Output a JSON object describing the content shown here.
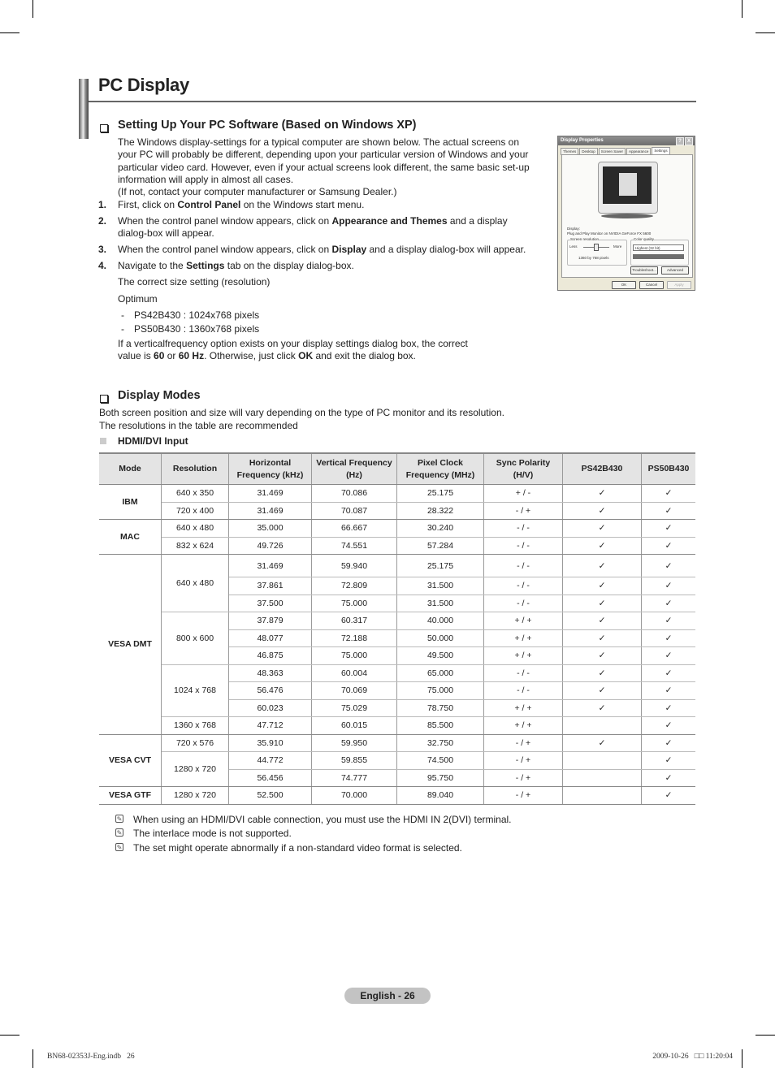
{
  "page": {
    "title": "PC Display",
    "page_label": "English - 26",
    "footer_left": "BN68-02353J-Eng.indb   26",
    "footer_right": "2009-10-26   □□ 11:20:04"
  },
  "setup_section": {
    "heading": "Setting Up Your PC Software (Based on Windows XP)",
    "intro": "The Windows display-settings for a typical computer are shown below. The actual screens on your PC will probably be different, depending upon your particular version of Windows and your particular video card. However, even if your actual screens look different, the same basic set-up information will apply in almost all cases.",
    "intro_note": "(If not, contact your computer manufacturer or Samsung Dealer.)",
    "steps": [
      {
        "num": "1.",
        "before": "First, click on ",
        "bold": "Control Panel",
        "after": " on the Windows start menu."
      },
      {
        "num": "2.",
        "before": "When the control panel window appears, click on ",
        "bold": "Appearance and Themes",
        "after": " and a display dialog-box will appear."
      },
      {
        "num": "3.",
        "before": "When the control panel window appears, click on ",
        "bold": "Display",
        "after": " and a display dialog-box will appear."
      },
      {
        "num": "4.",
        "before": "Navigate to the ",
        "bold": "Settings",
        "after": " tab on the display dialog-box."
      }
    ],
    "correct_size": "The correct size setting (resolution)",
    "optimum": "Optimum",
    "optimum_items": [
      "PS42B430 : 1024x768 pixels",
      "PS50B430 : 1360x768 pixels"
    ],
    "freq_text_1": "If a verticalfrequency option exists on your display settings dialog box, the correct",
    "freq_text_2_a": "value is ",
    "freq_text_2_b1": "60",
    "freq_text_2_c": " or ",
    "freq_text_2_b2": "60 Hz",
    "freq_text_2_d": ". Otherwise, just click ",
    "freq_text_2_b3": "OK",
    "freq_text_2_e": " and exit the dialog box."
  },
  "dialog": {
    "title": "Display Properties",
    "help_btn": "?",
    "close_btn": "X",
    "tabs": [
      "Themes",
      "Desktop",
      "Screen Saver",
      "Appearance",
      "Settings"
    ],
    "active_tab": "Settings",
    "display_label": "Display:",
    "display_value": "Plug and Play Monitor on NVIDIA GeForce FX 5600",
    "resolution_group": "Screen resolution",
    "less": "Less",
    "more": "More",
    "resolution_value": "1360 by 768 pixels",
    "color_group": "Color quality",
    "color_value": "Highest (32 bit)",
    "troubleshoot": "Troubleshoot...",
    "advanced": "Advanced",
    "ok": "OK",
    "cancel": "Cancel",
    "apply": "Apply"
  },
  "modes_section": {
    "heading": "Display Modes",
    "desc_1": "Both screen position and size will vary depending on the type of PC monitor and its resolution.",
    "desc_2": "The resolutions in the table are recommended",
    "input_label": "HDMI/DVI Input",
    "check": "✓",
    "columns": [
      "Mode",
      "Resolution",
      "Horizontal Frequency (kHz)",
      "Vertical Frequency (Hz)",
      "Pixel Clock Frequency (MHz)",
      "Sync Polarity (H/V)",
      "PS42B430",
      "PS50B430"
    ],
    "rows": [
      {
        "mode": "IBM",
        "res": "640 x 350",
        "h": "31.469",
        "v": "70.086",
        "clk": "25.175",
        "sync": "+ / -",
        "ps42": true,
        "ps50": true
      },
      {
        "mode": "IBM",
        "res": "720 x 400",
        "h": "31.469",
        "v": "70.087",
        "clk": "28.322",
        "sync": "- / +",
        "ps42": true,
        "ps50": true
      },
      {
        "mode": "MAC",
        "res": "640 x 480",
        "h": "35.000",
        "v": "66.667",
        "clk": "30.240",
        "sync": "- / -",
        "ps42": true,
        "ps50": true
      },
      {
        "mode": "MAC",
        "res": "832 x 624",
        "h": "49.726",
        "v": "74.551",
        "clk": "57.284",
        "sync": "- / -",
        "ps42": true,
        "ps50": true
      },
      {
        "mode": "VESA DMT",
        "res": "640 x 480",
        "h": "31.469",
        "v": "59.940",
        "clk": "25.175",
        "sync": "- / -",
        "ps42": true,
        "ps50": true
      },
      {
        "mode": "VESA DMT",
        "res": "640 x 480",
        "h": "37.861",
        "v": "72.809",
        "clk": "31.500",
        "sync": "- / -",
        "ps42": true,
        "ps50": true
      },
      {
        "mode": "VESA DMT",
        "res": "640 x 480",
        "h": "37.500",
        "v": "75.000",
        "clk": "31.500",
        "sync": "- / -",
        "ps42": true,
        "ps50": true
      },
      {
        "mode": "VESA DMT",
        "res": "800 x 600",
        "h": "37.879",
        "v": "60.317",
        "clk": "40.000",
        "sync": "+ / +",
        "ps42": true,
        "ps50": true
      },
      {
        "mode": "VESA DMT",
        "res": "800 x 600",
        "h": "48.077",
        "v": "72.188",
        "clk": "50.000",
        "sync": "+ / +",
        "ps42": true,
        "ps50": true
      },
      {
        "mode": "VESA DMT",
        "res": "800 x 600",
        "h": "46.875",
        "v": "75.000",
        "clk": "49.500",
        "sync": "+ / +",
        "ps42": true,
        "ps50": true
      },
      {
        "mode": "VESA DMT",
        "res": "1024 x 768",
        "h": "48.363",
        "v": "60.004",
        "clk": "65.000",
        "sync": "- / -",
        "ps42": true,
        "ps50": true
      },
      {
        "mode": "VESA DMT",
        "res": "1024 x 768",
        "h": "56.476",
        "v": "70.069",
        "clk": "75.000",
        "sync": "- / -",
        "ps42": true,
        "ps50": true
      },
      {
        "mode": "VESA DMT",
        "res": "1024 x 768",
        "h": "60.023",
        "v": "75.029",
        "clk": "78.750",
        "sync": "+ / +",
        "ps42": true,
        "ps50": true
      },
      {
        "mode": "VESA DMT",
        "res": "1360 x 768",
        "h": "47.712",
        "v": "60.015",
        "clk": "85.500",
        "sync": "+ / +",
        "ps42": false,
        "ps50": true
      },
      {
        "mode": "VESA CVT",
        "res": "720 x 576",
        "h": "35.910",
        "v": "59.950",
        "clk": "32.750",
        "sync": "- / +",
        "ps42": true,
        "ps50": true
      },
      {
        "mode": "VESA CVT",
        "res": "1280 x 720",
        "h": "44.772",
        "v": "59.855",
        "clk": "74.500",
        "sync": "- / +",
        "ps42": false,
        "ps50": true
      },
      {
        "mode": "VESA CVT",
        "res": "1280 x 720",
        "h": "56.456",
        "v": "74.777",
        "clk": "95.750",
        "sync": "- / +",
        "ps42": false,
        "ps50": true
      },
      {
        "mode": "VESA GTF",
        "res": "1280 x 720",
        "h": "52.500",
        "v": "70.000",
        "clk": "89.040",
        "sync": "- / +",
        "ps42": false,
        "ps50": true
      }
    ],
    "notes": [
      "When using an HDMI/DVI cable connection, you must use the HDMI IN 2(DVI) terminal.",
      "The interlace mode is not supported.",
      "The set might operate abnormally if a non-standard video format is selected."
    ]
  }
}
